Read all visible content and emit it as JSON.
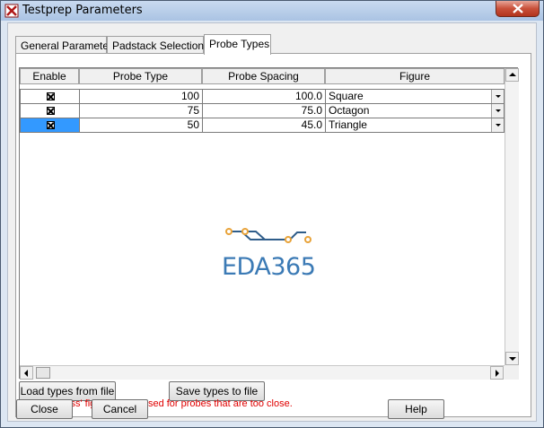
{
  "window": {
    "title": "Testprep Parameters"
  },
  "tabs": [
    {
      "label": "General Parameters"
    },
    {
      "label": "Padstack Selections"
    },
    {
      "label": "Probe Types"
    }
  ],
  "active_tab": "Probe Types",
  "grid": {
    "columns": [
      "Enable",
      "Probe Type",
      "Probe Spacing",
      "Figure"
    ],
    "rows": [
      {
        "enabled": true,
        "probe_type": "100",
        "probe_spacing": "100.0",
        "figure": "Square"
      },
      {
        "enabled": true,
        "probe_type": "75",
        "probe_spacing": "75.0",
        "figure": "Octagon"
      },
      {
        "enabled": true,
        "probe_type": "50",
        "probe_spacing": "45.0",
        "figure": "Triangle"
      }
    ],
    "selected_row": 2
  },
  "watermark": {
    "text": "EDA365"
  },
  "buttons": {
    "load": "Load types from file",
    "save": "Save types to file",
    "close": "Close",
    "cancel": "Cancel",
    "help": "Help"
  },
  "note": "NOTE: 'Cross' figure will be used for probes that are too close.",
  "colors": {
    "selection": "#3399ff",
    "note": "#e00000",
    "logo_blue": "#3b7ab5",
    "logo_orange": "#e8a33a"
  }
}
